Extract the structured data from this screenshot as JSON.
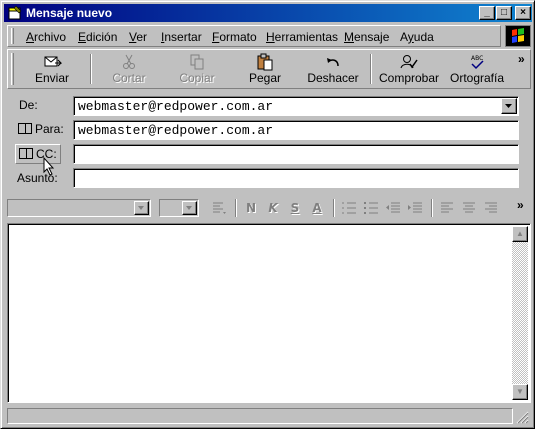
{
  "window": {
    "title": "Mensaje nuevo"
  },
  "caption_buttons": {
    "minimize": "_",
    "maximize": "□",
    "close": "×"
  },
  "menu": [
    {
      "label": "Archivo",
      "key": "A"
    },
    {
      "label": "Edición",
      "key": "E"
    },
    {
      "label": "Ver",
      "key": "V"
    },
    {
      "label": "Insertar",
      "key": "I"
    },
    {
      "label": "Formato",
      "key": "F"
    },
    {
      "label": "Herramientas",
      "key": "H"
    },
    {
      "label": "Mensaje",
      "key": "M"
    },
    {
      "label": "Ayuda",
      "key": "y"
    }
  ],
  "toolbar": [
    {
      "label": "Enviar",
      "icon": "send-icon",
      "enabled": true
    },
    {
      "label": "Cortar",
      "icon": "scissors-icon",
      "enabled": false
    },
    {
      "label": "Copiar",
      "icon": "copy-icon",
      "enabled": false
    },
    {
      "label": "Pegar",
      "icon": "paste-icon",
      "enabled": true
    },
    {
      "label": "Deshacer",
      "icon": "undo-icon",
      "enabled": true
    },
    {
      "label": "Comprobar",
      "icon": "check-names-icon",
      "enabled": true
    },
    {
      "label": "Ortografía",
      "icon": "spelling-icon",
      "enabled": true
    }
  ],
  "toolbar_overflow": "»",
  "header": {
    "from_label": "De:",
    "from_value": "webmaster@redpower.com.ar",
    "to_label": "Para:",
    "to_value": "webmaster@redpower.com.ar",
    "cc_label": "CC:",
    "cc_value": "",
    "subject_label": "Asunto:",
    "subject_value": ""
  },
  "format_toolbar": {
    "bold": "N",
    "italic": "K",
    "underline": "S",
    "color": "A",
    "overflow": "»"
  },
  "body": {
    "text": ""
  },
  "status": {
    "text": ""
  }
}
